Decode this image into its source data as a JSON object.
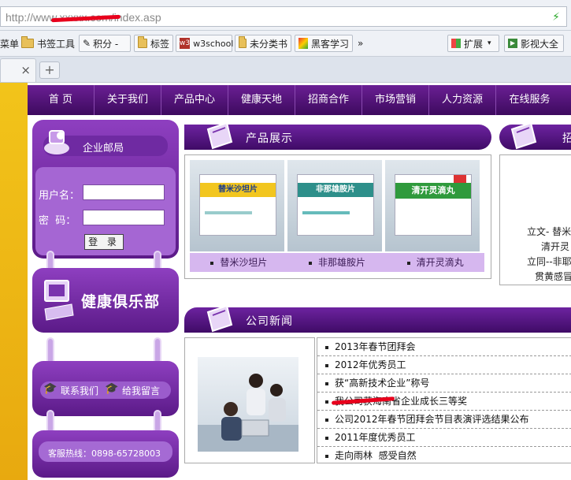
{
  "browser": {
    "url": "http://www.xxxxx.com/index.asp",
    "bookmarks": [
      "菜单",
      "书签工具",
      "积分 -",
      "标签",
      "w3school",
      "未分类书",
      "黑客学习",
      "»",
      "扩展",
      "影视大全"
    ],
    "tab_close": "×",
    "new_tab": "+"
  },
  "nav": {
    "items": [
      "首 页",
      "关于我们",
      "产品中心",
      "健康天地",
      "招商合作",
      "市场营销",
      "人力资源",
      "在线服务"
    ]
  },
  "left": {
    "mail_title": "企业邮局",
    "username_label": "用户名：",
    "password_label": "密  码：",
    "login_button": "登 录",
    "club_title": "健康俱乐部",
    "contact_link": "联系我们",
    "message_link": "给我留言",
    "hotline": "客服热线：0898-65728003"
  },
  "products": {
    "title": "产品展示",
    "items": [
      {
        "name": "替米沙坦片",
        "box_label": "替米沙坦片",
        "color": "#f2c61f"
      },
      {
        "name": "非那雄胺片",
        "box_label": "非那雄胺片",
        "color": "#2d8f8a"
      },
      {
        "name": "清开灵滴丸",
        "box_label": "清开灵滴丸",
        "color": "#2f9a3c"
      }
    ]
  },
  "recruit": {
    "title": "招",
    "lines": [
      "立文- 替米",
      "清开灵",
      "立同--非耶",
      "贯黄感冒"
    ]
  },
  "news": {
    "title": "公司新闻",
    "items": [
      "2013年春节团拜会",
      "2012年优秀员工",
      "获“高新技术企业”称号",
      "我公司获海南省企业成长三等奖",
      "公司2012年春节团拜会节目表演评选结果公布",
      "2011年度优秀员工",
      "走向雨林  感受自然"
    ]
  },
  "colors": {
    "nav": "#4a0f70",
    "accent": "#8e3fc0",
    "sidebar_yellow": "#f2c41a"
  }
}
